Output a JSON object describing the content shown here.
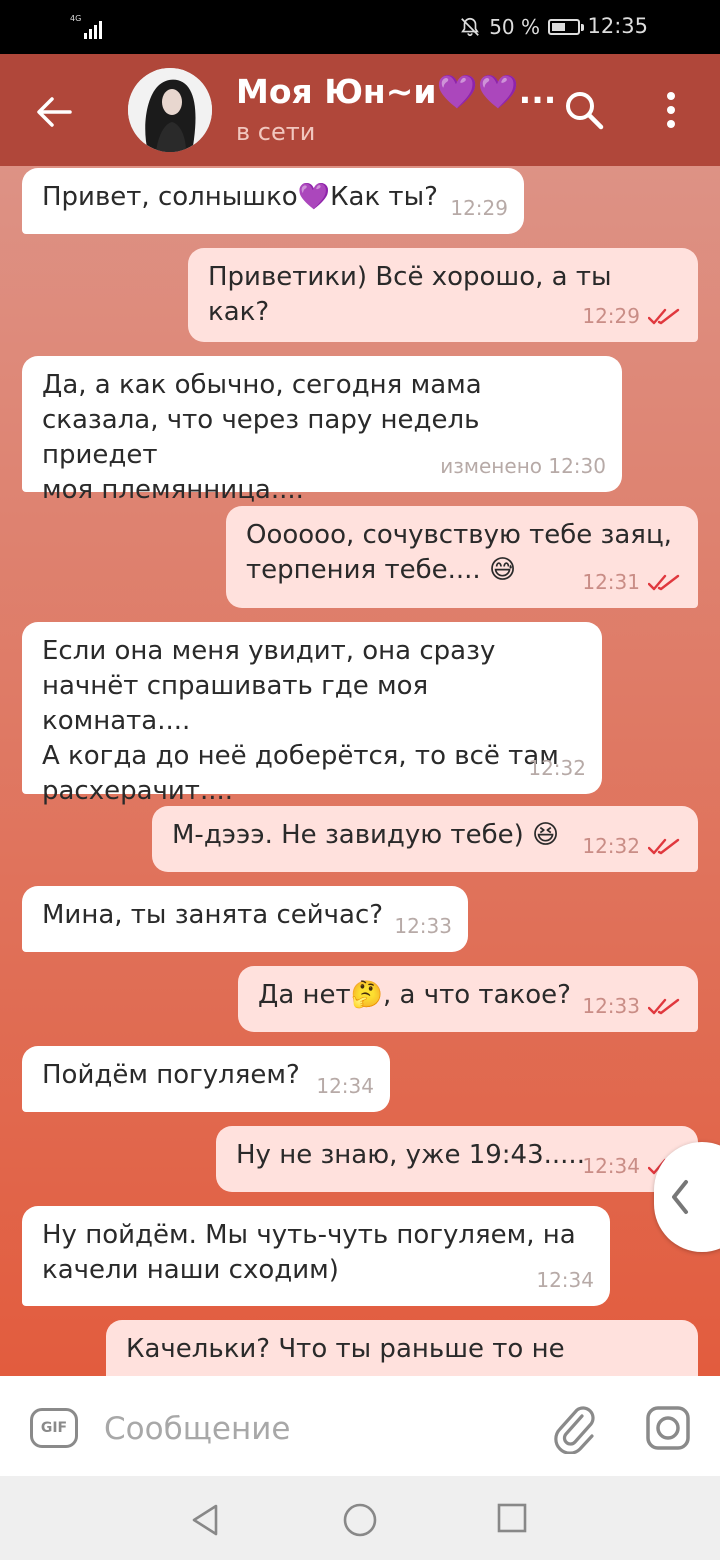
{
  "status_bar": {
    "network": "4G",
    "battery": "50 %",
    "battery_level_pct": 50,
    "time": "12:35"
  },
  "header": {
    "contact_name": "Моя Юн~и💜💜...",
    "status": "в сети"
  },
  "messages": [
    {
      "dir": "in",
      "text": "Привет, солнышко💜Как ты?",
      "time": "12:29"
    },
    {
      "dir": "out",
      "text": "Приветики) Всё хорошо, а ты как?",
      "time": "12:29",
      "read": true
    },
    {
      "dir": "in",
      "text": "Да, а как обычно, сегодня мама\nсказала, что через пару недель приедет\nмоя племянница....",
      "time": "изменено 12:30"
    },
    {
      "dir": "out",
      "text": "Оооооо, сочувствую тебе заяц,\nтерпения тебе.... 😅",
      "time": "12:31",
      "read": true
    },
    {
      "dir": "in",
      "text": "Если она меня увидит, она сразу\nначнёт спрашивать где моя комната....\nА когда до неё доберётся, то всё там\nрасхерачит....",
      "time": "12:32"
    },
    {
      "dir": "out",
      "text": "М-дэээ. Не завидую тебе) 😆",
      "time": "12:32",
      "read": true
    },
    {
      "dir": "in",
      "text": "Мина, ты занята сейчас?",
      "time": "12:33"
    },
    {
      "dir": "out",
      "text": "Да нет🤔, а что такое?",
      "time": "12:33",
      "read": true
    },
    {
      "dir": "in",
      "text": "Пойдём погуляем?",
      "time": "12:34"
    },
    {
      "dir": "out",
      "text": "Ну не знаю, уже 19:43.....",
      "time": "12:34",
      "read": true
    },
    {
      "dir": "in",
      "text": "Ну пойдём. Мы чуть-чуть погуляем, на\nкачели наши сходим)",
      "time": "12:34"
    },
    {
      "dir": "out",
      "text": "Качельки? Что ты раньше то не",
      "time": ""
    }
  ],
  "input": {
    "gif_label": "GIF",
    "placeholder": "Сообщение"
  },
  "icons": {
    "back": "arrow-left-icon",
    "search": "search-icon",
    "more": "more-vertical-icon",
    "attach": "paperclip-icon",
    "camera": "camera-icon"
  },
  "colors": {
    "header": "#b0473a",
    "incoming_bubble": "#ffffff",
    "outgoing_bubble": "#ffe1dd",
    "read_checks": "#e0383e"
  }
}
